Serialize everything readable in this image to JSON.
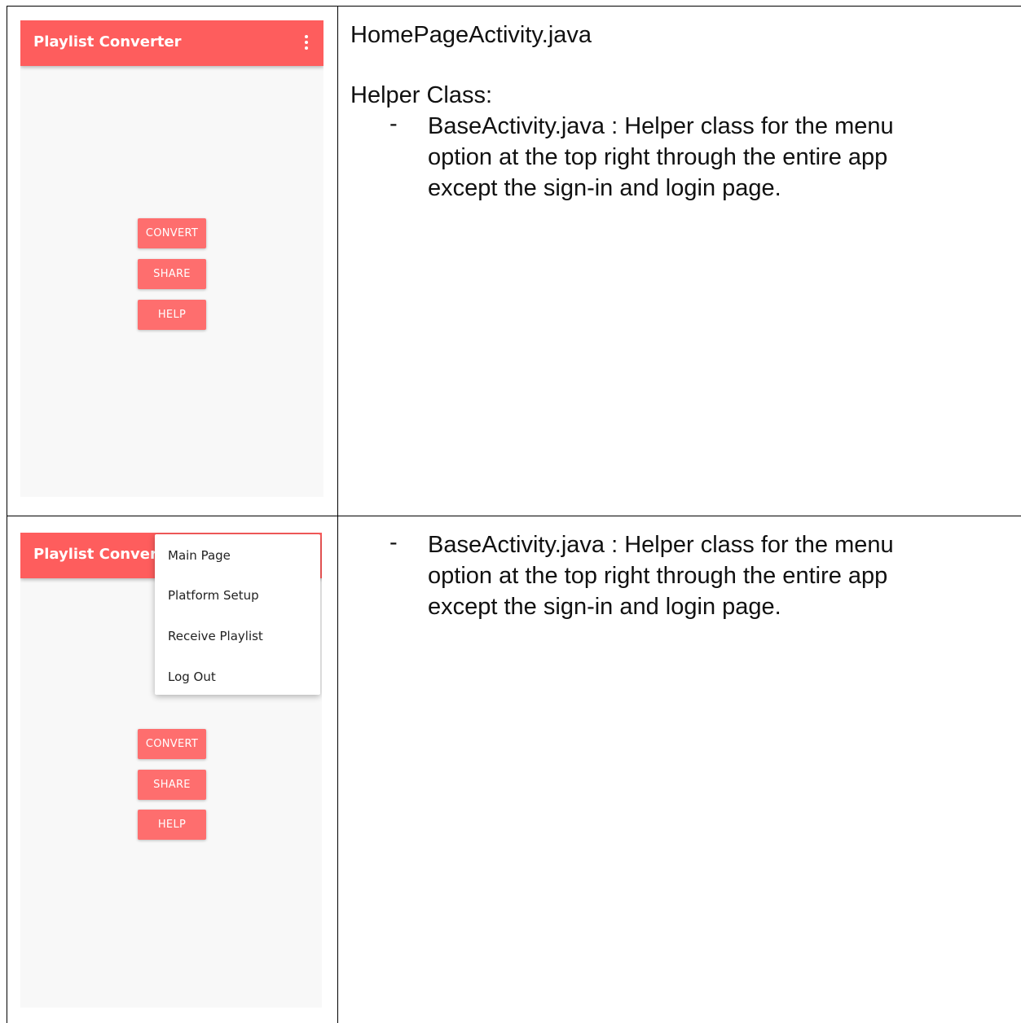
{
  "row1": {
    "phone": {
      "app_title": "Playlist Converter",
      "menu_icon": "more-vert-icon",
      "buttons": {
        "convert": "CONVERT",
        "share": "SHARE",
        "help": "HELP"
      }
    },
    "doc": {
      "file_name": "HomePageActivity.java",
      "helper_heading": "Helper Class:",
      "bullet_dash": "-",
      "bullet_lines": [
        "BaseActivity.java : Helper class for the menu",
        "option at the top right through the entire app",
        "except the sign-in and login page."
      ]
    }
  },
  "row2": {
    "phone": {
      "app_title": "Playlist Converte",
      "menu_items": [
        "Main Page",
        "Platform Setup",
        "Receive Playlist",
        "Log Out"
      ],
      "buttons": {
        "convert": "CONVERT",
        "share": "SHARE",
        "help": "HELP"
      }
    },
    "doc": {
      "bullet_dash": "-",
      "bullet_lines": [
        "BaseActivity.java : Helper class for the menu",
        "option at the top right through the entire app",
        "except the sign-in and login page."
      ]
    }
  },
  "colors": {
    "accent": "#fe5d5d",
    "button": "#fe6e6e",
    "phone_bg": "#f8f8f8"
  }
}
